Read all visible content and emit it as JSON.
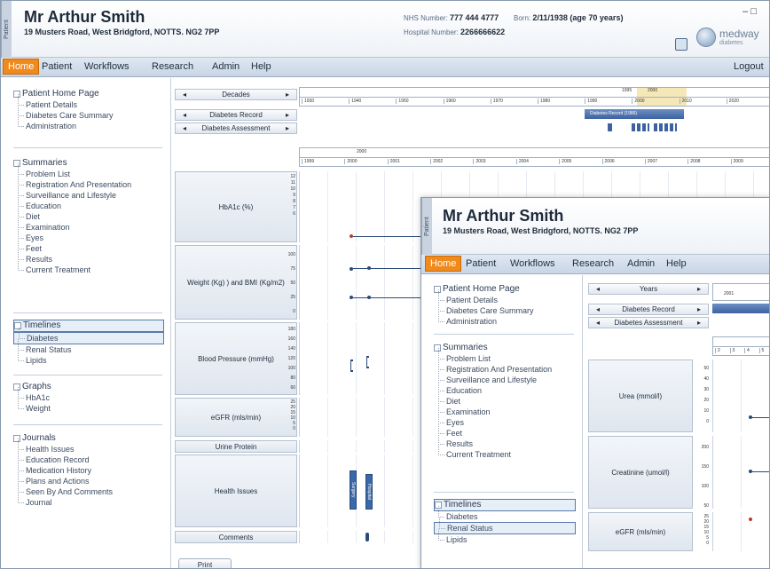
{
  "main": {
    "patient_tab": "Patient",
    "name": "Mr Arthur Smith",
    "address": "19 Musters Road, West Bridgford, NOTTS. NG2 7PP",
    "nhs_label": "NHS Number:",
    "nhs_value": "777 444 4777",
    "born_label": "Born:",
    "born_value": "2/11/1938 (age 70 years)",
    "hospital_label": "Hospital Number:",
    "hospital_value": "2266666622",
    "window_controls": "– □",
    "logo_title": "medway",
    "logo_sub": "diabetes",
    "menu": [
      "Home",
      "Patient",
      "Workflows",
      "Research",
      "Admin",
      "Help"
    ],
    "logout": "Logout",
    "sidebar": {
      "patient_home": {
        "title": "Patient Home Page",
        "items": [
          "Patient Details",
          "Diabetes Care Summary",
          "Administration"
        ]
      },
      "summaries": {
        "title": "Summaries",
        "items": [
          "Problem List",
          "Registration And Presentation",
          "Surveillance and Lifestyle",
          "Education",
          "Diet",
          "Examination",
          "Eyes",
          "Feet",
          "Results",
          "Current Treatment"
        ]
      },
      "timelines": {
        "title": "Timelines",
        "items": [
          "Diabetes",
          "Renal Status",
          "Lipids"
        ]
      },
      "graphs": {
        "title": "Graphs",
        "items": [
          "HbA1c",
          "Weight"
        ]
      },
      "journals": {
        "title": "Journals",
        "items": [
          "Health Issues",
          "Education Record",
          "Medication History",
          "Plans and Actions",
          "Seen By And Comments",
          "Journal"
        ]
      }
    },
    "timeline": {
      "decades_label": "Decades",
      "diabetes_record_label": "Diabetes Record",
      "diabetes_assessment_label": "Diabetes Assessment",
      "decade_ticks": [
        "1930",
        "1940",
        "1950",
        "1960",
        "1970",
        "1980",
        "1990",
        "2000",
        "2010",
        "2020"
      ],
      "decade_highlight": [
        "1995",
        "2000"
      ],
      "record_bar": "Diabetes Record (1986)",
      "year_group": "2000",
      "year_ticks": [
        "1999",
        "2000",
        "2001",
        "2002",
        "2003",
        "2004",
        "2005",
        "2006",
        "2007",
        "2008",
        "2009"
      ],
      "rows": {
        "hba1c": {
          "label": "HbA1c (%)",
          "axis": [
            "12",
            "11",
            "10",
            "9",
            "8",
            "7",
            "6"
          ]
        },
        "weight": {
          "label": "Weight (Kg) ) and BMI (Kg/m2)",
          "axis": [
            "100",
            "75",
            "50",
            "25",
            "0"
          ]
        },
        "bp": {
          "label": "Blood Pressure (mmHg)",
          "axis": [
            "180",
            "160",
            "140",
            "120",
            "100",
            "80",
            "60"
          ]
        },
        "egfr": {
          "label": "eGFR (mls/min)",
          "axis": [
            "25",
            "20",
            "15",
            "10",
            "5",
            "0"
          ]
        },
        "urine": {
          "label": "Urine Protein"
        },
        "health": {
          "label": "Health Issues",
          "bar1": "Surgery",
          "bar2": "Hospital"
        },
        "comments": {
          "label": "Comments"
        }
      },
      "print": "Print"
    }
  },
  "second": {
    "patient_tab": "Patient",
    "name": "Mr Arthur Smith",
    "address": "19 Musters Road, West Bridgford, NOTTS. NG2 7PP",
    "menu": [
      "Home",
      "Patient",
      "Workflows",
      "Research",
      "Admin",
      "Help"
    ],
    "sidebar": {
      "patient_home": {
        "title": "Patient Home Page",
        "items": [
          "Patient Details",
          "Diabetes Care Summary",
          "Administration"
        ]
      },
      "summaries": {
        "title": "Summaries",
        "items": [
          "Problem List",
          "Registration And Presentation",
          "Surveillance and Lifestyle",
          "Education",
          "Diet",
          "Examination",
          "Eyes",
          "Feet",
          "Results",
          "Current Treatment"
        ]
      },
      "timelines": {
        "title": "Timelines",
        "items": [
          "Diabetes",
          "Renal Status",
          "Lipids"
        ]
      }
    },
    "timeline": {
      "years_label": "Years",
      "diabetes_record_label": "Diabetes Record",
      "diabetes_assessment_label": "Diabetes Assessment",
      "year_tick": "2001",
      "months": [
        "2",
        "3",
        "4",
        "5"
      ],
      "rows": {
        "urea": {
          "label": "Urea (mmol/l)",
          "axis": [
            "50",
            "40",
            "30",
            "20",
            "10",
            "0"
          ]
        },
        "creatinine": {
          "label": "Creatinine (umol/l)",
          "axis": [
            "200",
            "150",
            "100",
            "50"
          ]
        },
        "egfr": {
          "label": "eGFR (mls/min)",
          "axis": [
            "25",
            "20",
            "15",
            "10",
            "5",
            "0"
          ]
        }
      }
    }
  }
}
